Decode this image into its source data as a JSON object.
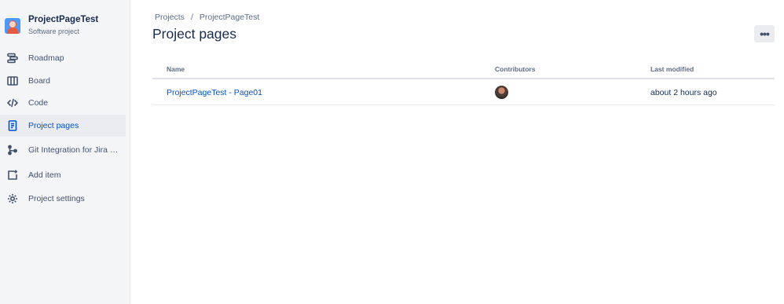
{
  "project": {
    "name": "ProjectPageTest",
    "type": "Software project"
  },
  "sidebar": {
    "items": [
      {
        "label": "Roadmap",
        "icon": "roadmap-icon"
      },
      {
        "label": "Board",
        "icon": "board-icon"
      },
      {
        "label": "Code",
        "icon": "code-icon"
      },
      {
        "label": "Project pages",
        "icon": "pages-icon",
        "active": true
      },
      {
        "label": "Git Integration for Jira S...",
        "icon": "git-icon"
      },
      {
        "label": "Add item",
        "icon": "add-item-icon"
      },
      {
        "label": "Project settings",
        "icon": "gear-icon"
      }
    ]
  },
  "breadcrumb": {
    "root": "Projects",
    "separator": "/",
    "current": "ProjectPageTest"
  },
  "page": {
    "title": "Project pages",
    "more_label": "•••"
  },
  "table": {
    "headers": {
      "name": "Name",
      "contributors": "Contributors",
      "last_modified": "Last modified"
    },
    "rows": [
      {
        "name": "ProjectPageTest - Page01",
        "last_modified": "about 2 hours ago"
      }
    ]
  },
  "colors": {
    "accent": "#0052cc",
    "sidebar_bg": "#f4f5f7",
    "text": "#172b4d"
  }
}
